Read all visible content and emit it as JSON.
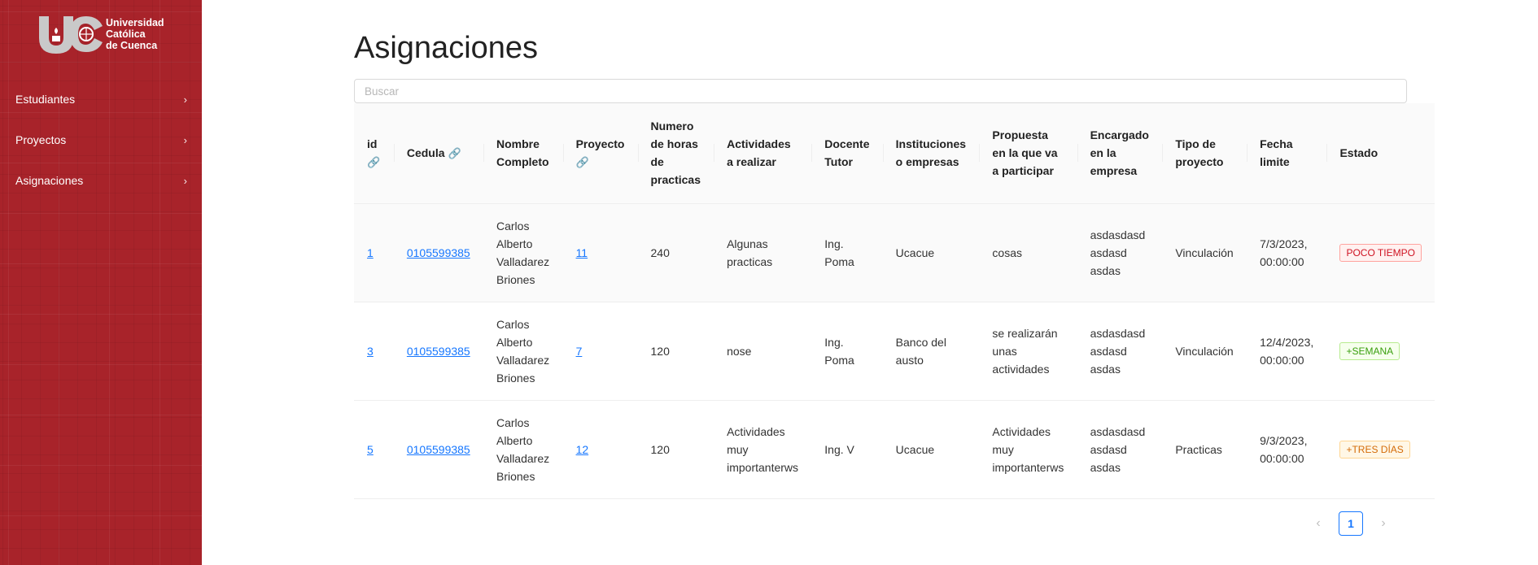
{
  "sidebar": {
    "logo": {
      "line1": "Universidad",
      "line2": "Católica",
      "line3": "de Cuenca"
    },
    "items": [
      {
        "label": "Estudiantes",
        "chevron": "›"
      },
      {
        "label": "Proyectos",
        "chevron": "›"
      },
      {
        "label": "Asignaciones",
        "chevron": "›"
      }
    ]
  },
  "main": {
    "title": "Asignaciones",
    "search_placeholder": "Buscar"
  },
  "table": {
    "columns": [
      {
        "label": "id",
        "link_icon": "🔗"
      },
      {
        "label": "Cedula",
        "link_icon": "🔗"
      },
      {
        "label": "Nombre Completo"
      },
      {
        "label": "Proyecto",
        "link_icon": "🔗"
      },
      {
        "label": "Numero de horas de practicas"
      },
      {
        "label": "Actividades a realizar"
      },
      {
        "label": "Docente Tutor"
      },
      {
        "label": "Instituciones o empresas"
      },
      {
        "label": "Propuesta en la que va a participar"
      },
      {
        "label": "Encargado en la empresa"
      },
      {
        "label": "Tipo de proyecto"
      },
      {
        "label": "Fecha limite"
      },
      {
        "label": "Estado"
      }
    ],
    "rows": [
      {
        "id": "1",
        "cedula": "0105599385",
        "nombre": "Carlos Alberto Valladarez Briones",
        "proyecto": "11",
        "horas": "240",
        "actividades": "Algunas practicas",
        "docente": "Ing. Poma",
        "institucion": "Ucacue",
        "propuesta": "cosas",
        "encargado": "asdasdasd asdasd asdas",
        "tipo": "Vinculación",
        "fecha": "7/3/2023, 00:00:00",
        "estado": "POCO TIEMPO"
      },
      {
        "id": "3",
        "cedula": "0105599385",
        "nombre": "Carlos Alberto Valladarez Briones",
        "proyecto": "7",
        "horas": "120",
        "actividades": "nose",
        "docente": "Ing. Poma",
        "institucion": "Banco del austo",
        "propuesta": "se realizarán unas actividades",
        "encargado": "asdasdasd asdasd asdas",
        "tipo": "Vinculación",
        "fecha": "12/4/2023, 00:00:00",
        "estado": "+SEMANA"
      },
      {
        "id": "5",
        "cedula": "0105599385",
        "nombre": "Carlos Alberto Valladarez Briones",
        "proyecto": "12",
        "horas": "120",
        "actividades": "Actividades muy importanterws",
        "docente": "Ing. V",
        "institucion": "Ucacue",
        "propuesta": "Actividades muy importanterws",
        "encargado": "asdasdasd asdasd asdas",
        "tipo": "Practicas",
        "fecha": "9/3/2023, 00:00:00",
        "estado": "+TRES DÍAS"
      }
    ]
  },
  "pagination": {
    "prev": "‹",
    "current": "1",
    "next": "›"
  },
  "colors": {
    "sidebar_bg": "#a8232a",
    "link": "#1677ff",
    "tag_red": "#cf1322",
    "tag_green": "#389e0d",
    "tag_orange": "#d46b08"
  }
}
